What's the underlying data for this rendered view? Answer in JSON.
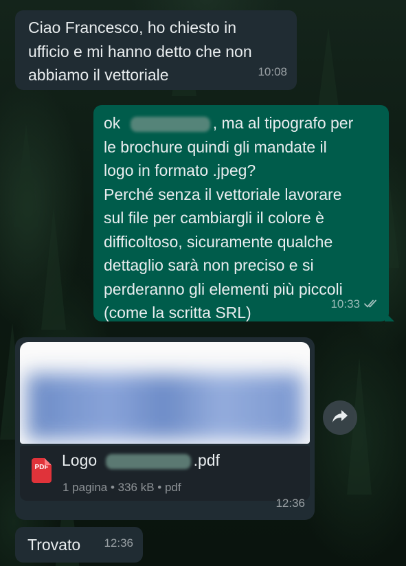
{
  "messages": [
    {
      "direction": "incoming",
      "text": "Ciao Francesco, ho chiesto in ufficio e mi hanno detto che non abbiamo il vettoriale",
      "lines": [
        "Ciao Francesco, ho chiesto in",
        "ufficio e mi hanno detto che non",
        "abbiamo il vettoriale"
      ],
      "time": "10:08"
    },
    {
      "direction": "outgoing",
      "line1_start": "ok",
      "line1_end": ", ma al tipografo per",
      "lines": [
        "le brochure quindi gli mandate il",
        "logo in formato .jpeg?",
        "Perché senza il vettoriale lavorare",
        "sul file per cambiargli il colore è",
        "difficoltoso, sicuramente qualche",
        "dettaglio sarà non preciso e si",
        "perderanno gli elementi più piccoli",
        "(come la scritta SRL)"
      ],
      "time": "10:33",
      "status_icon": "double-check-read-icon"
    },
    {
      "direction": "incoming",
      "type": "document",
      "file_icon": "pdf-icon",
      "file_icon_label": "PDF",
      "file_name_start": "Logo",
      "file_name_end": ".pdf",
      "file_meta": "1 pagina • 336 kB • pdf",
      "time": "12:36"
    },
    {
      "direction": "incoming",
      "text": "Trovato",
      "time": "12:36"
    }
  ],
  "colors": {
    "incoming_bubble": "#202c33",
    "outgoing_bubble": "#005c4b",
    "pdf_icon": "#e0333a"
  },
  "icons": {
    "forward": "forward-arrow-icon"
  }
}
